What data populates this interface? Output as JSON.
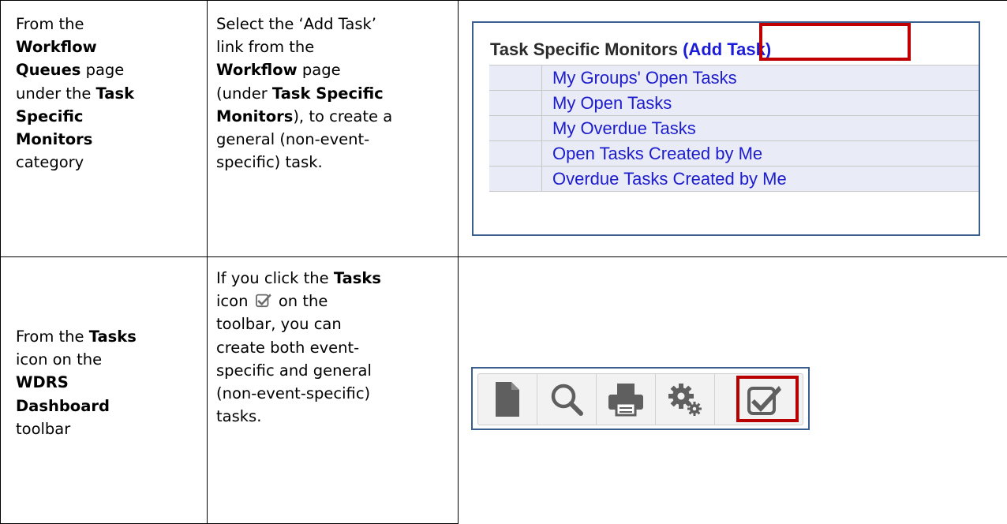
{
  "rows": [
    {
      "where": [
        [
          {
            "t": "From the",
            "b": false
          }
        ],
        [
          {
            "t": "Workflow",
            "b": true
          }
        ],
        [
          {
            "t": "Queues",
            "b": true
          },
          {
            "t": " page",
            "b": false
          }
        ],
        [
          {
            "t": "under the ",
            "b": false
          },
          {
            "t": "Task",
            "b": true
          }
        ],
        [
          {
            "t": "Specific",
            "b": true
          }
        ],
        [
          {
            "t": "Monitors",
            "b": true
          }
        ],
        [
          {
            "t": "category",
            "b": false
          }
        ]
      ],
      "how": [
        [
          {
            "t": "Select the ‘Add Task’",
            "b": false
          }
        ],
        [
          {
            "t": "link from the",
            "b": false
          }
        ],
        [
          {
            "t": "Workflow",
            "b": true
          },
          {
            "t": " page",
            "b": false
          }
        ],
        [
          {
            "t": "(under ",
            "b": false
          },
          {
            "t": "Task Specific",
            "b": true
          }
        ],
        [
          {
            "t": "Monitors",
            "b": true
          },
          {
            "t": "), to create a",
            "b": false
          }
        ],
        [
          {
            "t": "general (non-event-",
            "b": false
          }
        ],
        [
          {
            "t": "specific) task.",
            "b": false
          }
        ]
      ]
    },
    {
      "where": [
        [
          {
            "t": "From the ",
            "b": false
          },
          {
            "t": "Tasks",
            "b": true
          }
        ],
        [
          {
            "t": "icon on the",
            "b": false
          }
        ],
        [
          {
            "t": "WDRS",
            "b": true
          }
        ],
        [
          {
            "t": "Dashboard",
            "b": true
          }
        ],
        [
          {
            "t": "toolbar",
            "b": false
          }
        ]
      ],
      "how": [
        [
          {
            "t": "If you click the ",
            "b": false
          },
          {
            "t": "Tasks",
            "b": true
          }
        ],
        [
          {
            "t": "icon ",
            "b": false
          },
          {
            "icon": "tasks-checkbox-icon"
          },
          {
            "t": " on the",
            "b": false
          }
        ],
        [
          {
            "t": "toolbar, you can",
            "b": false
          }
        ],
        [
          {
            "t": "create both event-",
            "b": false
          }
        ],
        [
          {
            "t": "specific and general",
            "b": false
          }
        ],
        [
          {
            "t": "(non-event-specific)",
            "b": false
          }
        ],
        [
          {
            "t": "tasks.",
            "b": false
          }
        ]
      ]
    }
  ],
  "workflow_shot": {
    "header_label": "Task Specific Monitors",
    "add_task_link": "(Add Task)",
    "links": [
      "My Groups' Open Tasks",
      "My Open Tasks",
      "My Overdue Tasks",
      "Open Tasks Created by Me",
      "Overdue Tasks Created by Me"
    ],
    "highlight_color": "#c00000",
    "link_color": "#1c1ccc"
  },
  "toolbar_shot": {
    "buttons": [
      {
        "name": "document",
        "icon": "document-icon"
      },
      {
        "name": "search",
        "icon": "search-icon"
      },
      {
        "name": "print",
        "icon": "printer-icon"
      },
      {
        "name": "settings",
        "icon": "gears-icon"
      },
      {
        "name": "tasks",
        "icon": "tasks-checkbox-icon"
      }
    ],
    "highlighted": "tasks",
    "highlight_color": "#b80000"
  }
}
